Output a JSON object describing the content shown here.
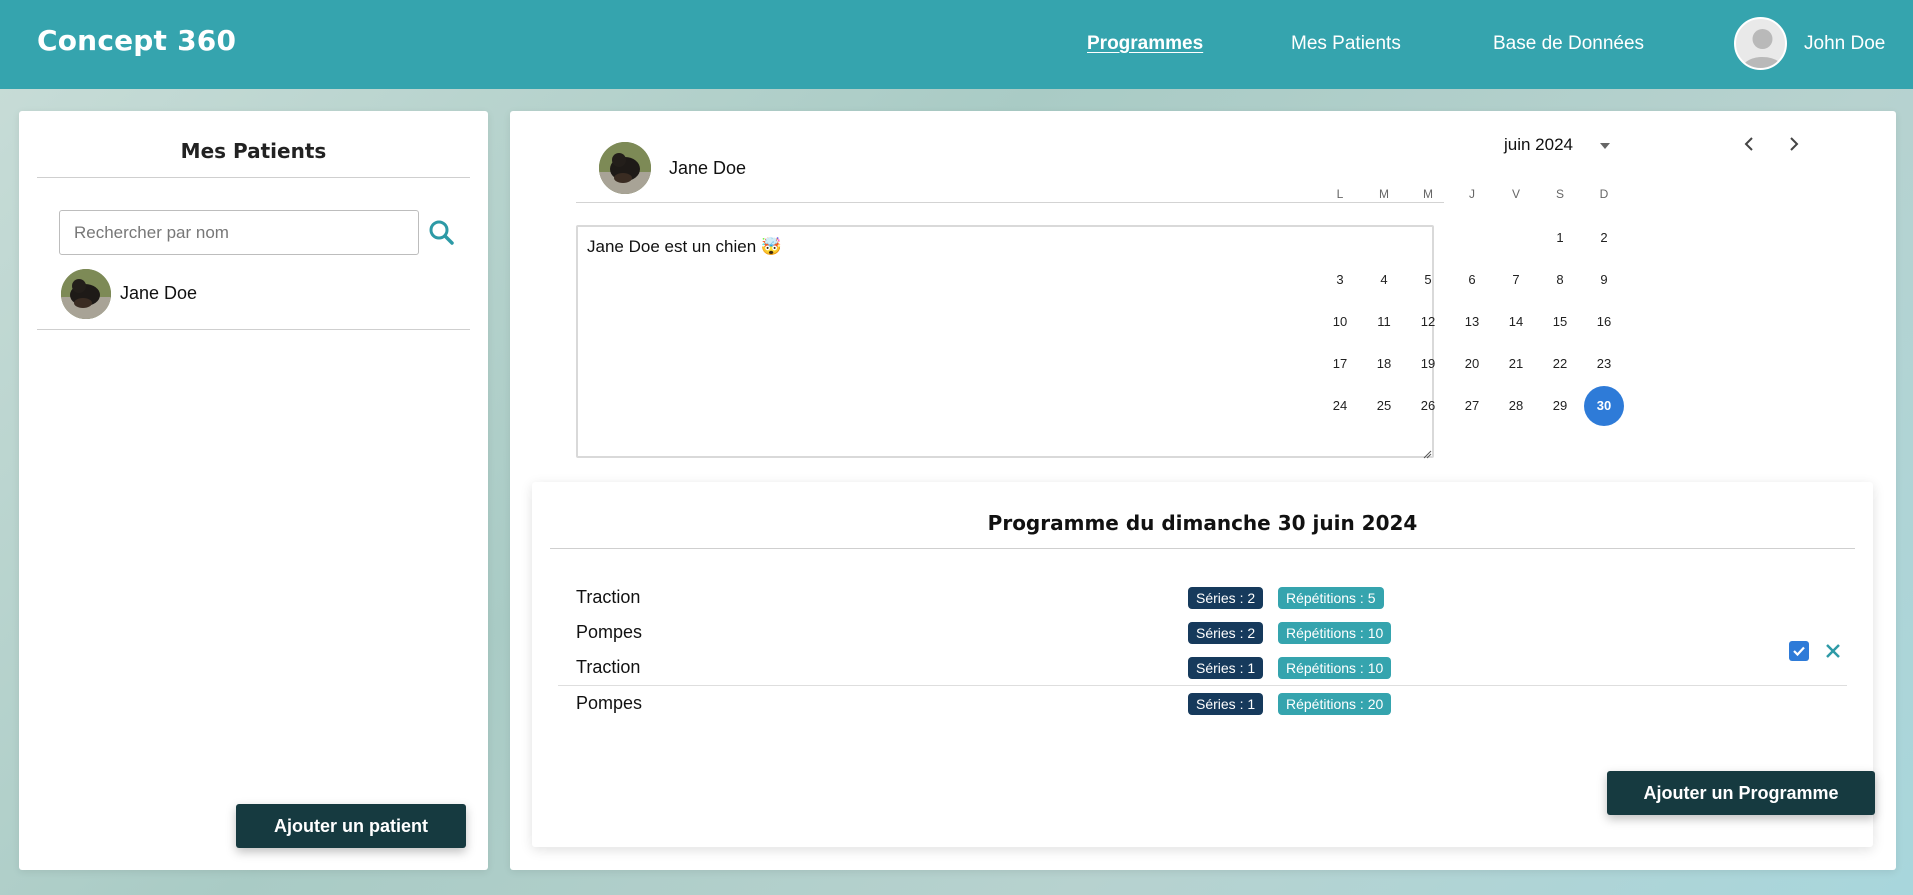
{
  "header": {
    "brand": "Concept 360",
    "nav": [
      {
        "label": "Programmes",
        "active": true
      },
      {
        "label": "Mes Patients",
        "active": false
      },
      {
        "label": "Base de Données",
        "active": false
      }
    ],
    "user_name": "John Doe",
    "user_avatar_icon": "user-avatar-icon"
  },
  "sidebar": {
    "title": "Mes Patients",
    "search_placeholder": "Rechercher par nom",
    "search_icon": "search-icon",
    "patients": [
      {
        "name": "Jane Doe"
      }
    ],
    "add_button": "Ajouter un patient"
  },
  "patient": {
    "name": "Jane Doe",
    "notes": "Jane Doe est un chien 🤯"
  },
  "calendar": {
    "month_label": "juin 2024",
    "weekdays": [
      "L",
      "M",
      "M",
      "J",
      "V",
      "S",
      "D"
    ],
    "first_weekday_offset": 5,
    "days_in_month": 30,
    "selected_day": 30,
    "selected_color": "#2e7bd8"
  },
  "program": {
    "title": "Programme du dimanche 30 juin 2024",
    "exercises": [
      {
        "name": "Traction",
        "series": "Séries : 2",
        "reps": "Répétitions : 5"
      },
      {
        "name": "Pompes",
        "series": "Séries : 2",
        "reps": "Répétitions : 10"
      },
      {
        "name": "Traction",
        "series": "Séries : 1",
        "reps": "Répétitions : 10"
      },
      {
        "name": "Pompes",
        "series": "Séries : 1",
        "reps": "Répétitions : 20"
      }
    ],
    "completed": true,
    "add_button": "Ajouter un Programme"
  },
  "colors": {
    "header": "#35a4ae",
    "dark_button": "#163a40",
    "series_badge": "#163a5c",
    "reps_badge": "#35a4ae"
  }
}
